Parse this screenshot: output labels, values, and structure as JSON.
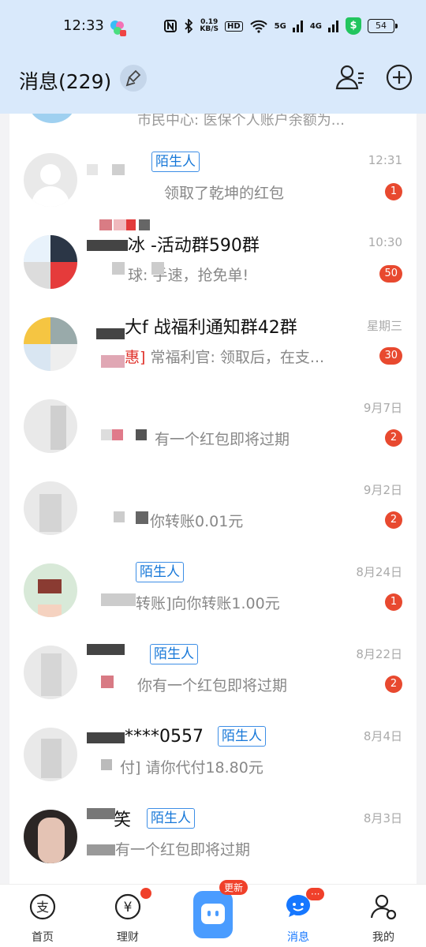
{
  "status_bar": {
    "time": "12:33",
    "speed_top": "0.19",
    "speed_unit": "KB/S",
    "hd_label": "HD",
    "network_5g": "5G",
    "network_4g": "4G",
    "battery": "54",
    "icons": [
      "nfc-icon",
      "bluetooth-icon",
      "wifi-icon",
      "signal-icon",
      "shield-icon",
      "battery-icon"
    ]
  },
  "header": {
    "title": "消息(229)",
    "icons": [
      "broom-icon",
      "contacts-icon",
      "add-icon"
    ]
  },
  "peek_row": {
    "preview": "市民中心: 医保个人账户余额为..."
  },
  "messages": [
    {
      "name": "",
      "tag": "陌生人",
      "time": "12:31",
      "preview_prefix": "",
      "preview": "领取了乾坤的红包",
      "badge": "1"
    },
    {
      "name": "冰  -活动群590群",
      "tag": "",
      "time": "10:30",
      "preview_prefix": "",
      "preview": "球: 手速，抢免单!",
      "badge": "50"
    },
    {
      "name": "大f  战福利通知群42群",
      "tag": "",
      "time": "星期三",
      "preview_prefix": "惠]",
      "preview": "常福利官: 领取后，在支...",
      "badge": "30"
    },
    {
      "name": "",
      "tag": "",
      "time": "9月7日",
      "preview_prefix": "",
      "preview": "有一个红包即将过期",
      "badge": "2"
    },
    {
      "name": "",
      "tag": "",
      "time": "9月2日",
      "preview_prefix": "",
      "preview": "你转账0.01元",
      "badge": "2"
    },
    {
      "name": "",
      "tag": "陌生人",
      "time": "8月24日",
      "preview_prefix": "",
      "preview": "转账]向你转账1.00元",
      "badge": "1"
    },
    {
      "name": "",
      "tag": "陌生人",
      "time": "8月22日",
      "preview_prefix": "",
      "preview": "你有一个红包即将过期",
      "badge": "2"
    },
    {
      "name": "****0557",
      "tag": "陌生人",
      "time": "8月4日",
      "preview_prefix": "",
      "preview": "付] 请你代付18.80元",
      "badge": ""
    },
    {
      "name": "笑",
      "tag": "陌生人",
      "time": "8月3日",
      "preview_prefix": "",
      "preview": "有一个红包即将过期",
      "badge": ""
    }
  ],
  "tab_bar": {
    "tabs": [
      {
        "label": "首页",
        "icon": "alipay-home-icon"
      },
      {
        "label": "理财",
        "icon": "yuan-wealth-icon"
      },
      {
        "label": "",
        "icon": "assistant-icon",
        "pill": "更新"
      },
      {
        "label": "消息",
        "icon": "message-chat-icon",
        "pill": "···"
      },
      {
        "label": "我的",
        "icon": "profile-icon"
      }
    ],
    "active": "消息",
    "colors": {
      "active": "#1677ff",
      "badge": "#f0402a"
    }
  }
}
